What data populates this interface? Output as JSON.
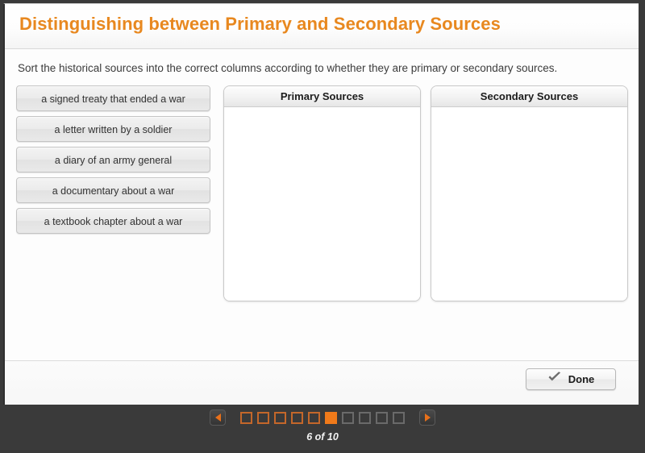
{
  "header": {
    "title": "Distinguishing between Primary and Secondary Sources"
  },
  "body": {
    "instructions": "Sort the historical sources into the correct columns according to whether they are primary or secondary sources."
  },
  "sources": [
    {
      "label": "a signed treaty that ended a war"
    },
    {
      "label": "a letter written by a soldier"
    },
    {
      "label": "a diary of an army general"
    },
    {
      "label": "a documentary about a war"
    },
    {
      "label": "a textbook chapter about a war"
    }
  ],
  "dropzones": [
    {
      "title": "Primary Sources",
      "items": []
    },
    {
      "title": "Secondary Sources",
      "items": []
    }
  ],
  "footer": {
    "done_label": "Done",
    "done_icon": "check-icon"
  },
  "pager": {
    "prev_icon": "triangle-left-icon",
    "next_icon": "triangle-right-icon",
    "current_page": 6,
    "total_pages": 10,
    "label": "6 of 10",
    "dots": [
      {
        "state": "visited"
      },
      {
        "state": "visited"
      },
      {
        "state": "visited"
      },
      {
        "state": "visited"
      },
      {
        "state": "visited"
      },
      {
        "state": "current"
      },
      {
        "state": "unvisited"
      },
      {
        "state": "unvisited"
      },
      {
        "state": "unvisited"
      },
      {
        "state": "unvisited"
      }
    ]
  },
  "colors": {
    "title_orange": "#e8881f",
    "accent_orange": "#f07a1a",
    "visited_orange": "#c4672a",
    "pager_background": "#3a3a3a",
    "card_background": "#ffffff",
    "chip_border": "#c4c4c4"
  }
}
